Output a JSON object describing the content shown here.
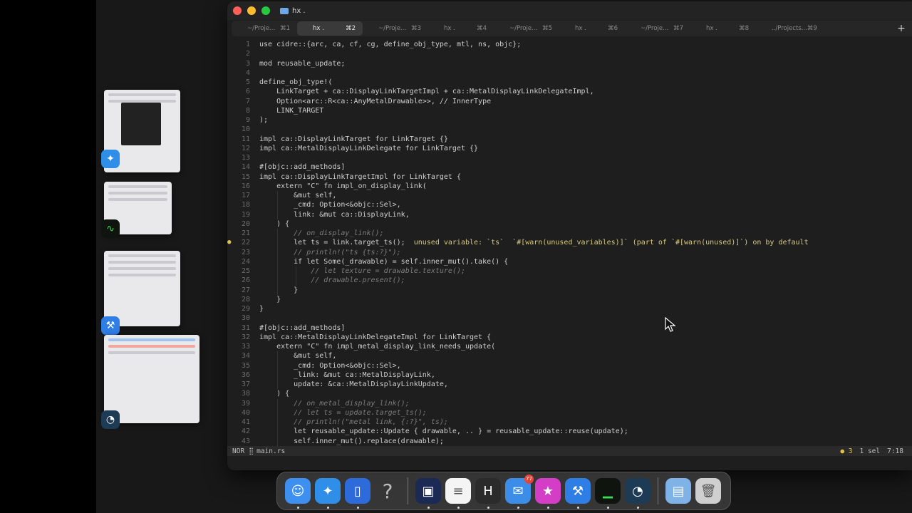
{
  "window": {
    "title": "hx .",
    "tabs": [
      {
        "label": "~/Proje...",
        "shortcut": "⌘1"
      },
      {
        "label": "hx .",
        "shortcut": "⌘2"
      },
      {
        "label": "~/Proje...",
        "shortcut": "⌘3"
      },
      {
        "label": "hx .",
        "shortcut": "⌘4"
      },
      {
        "label": "~/Proje...",
        "shortcut": "⌘5"
      },
      {
        "label": "hx .",
        "shortcut": "⌘6"
      },
      {
        "label": "~/Proje...",
        "shortcut": "⌘7"
      },
      {
        "label": "hx .",
        "shortcut": "⌘8"
      },
      {
        "label": "../Projects...",
        "shortcut": "⌘9"
      }
    ],
    "active_tab": 1,
    "new_tab_label": "+"
  },
  "editor": {
    "lines": [
      {
        "n": "1",
        "text": "use cidre::{arc, ca, cf, cg, define_obj_type, mtl, ns, objc};"
      },
      {
        "n": "2",
        "text": ""
      },
      {
        "n": "3",
        "text": "mod reusable_update;"
      },
      {
        "n": "4",
        "text": ""
      },
      {
        "n": "5",
        "text": "define_obj_type!("
      },
      {
        "n": "6",
        "text": "    LinkTarget + ca::DisplayLinkTargetImpl + ca::MetalDisplayLinkDelegateImpl,"
      },
      {
        "n": "7",
        "text": "    Option<arc::R<ca::AnyMetalDrawable>>, // InnerType"
      },
      {
        "n": "8",
        "text": "    LINK_TARGET"
      },
      {
        "n": "9",
        "text": ");"
      },
      {
        "n": "10",
        "text": ""
      },
      {
        "n": "11",
        "text": "impl ca::DisplayLinkTarget for LinkTarget {}"
      },
      {
        "n": "12",
        "text": "impl ca::MetalDisplayLinkDelegate for LinkTarget {}"
      },
      {
        "n": "13",
        "text": ""
      },
      {
        "n": "14",
        "text": "#[objc::add_methods]"
      },
      {
        "n": "15",
        "text": "impl ca::DisplayLinkTargetImpl for LinkTarget {"
      },
      {
        "n": "16",
        "text": "    extern \"C\" fn impl_on_display_link("
      },
      {
        "n": "17",
        "text": "        &mut self,"
      },
      {
        "n": "18",
        "text": "        _cmd: Option<&objc::Sel>,"
      },
      {
        "n": "19",
        "text": "        link: &mut ca::DisplayLink,"
      },
      {
        "n": "20",
        "text": "    ) {"
      },
      {
        "n": "21",
        "text": "        // on_display_link();"
      },
      {
        "n": "22",
        "text": "        let ts = link.target_ts();",
        "diagnostic": "  unused variable: `ts`  `#[warn(unused_variables)]` (part of `#[warn(unused)]`) on by default"
      },
      {
        "n": "23",
        "text": "        // println!(\"ts {ts:?}\");"
      },
      {
        "n": "24",
        "text": "        if let Some(_drawable) = self.inner_mut().take() {"
      },
      {
        "n": "25",
        "text": "            // let texture = drawable.texture();"
      },
      {
        "n": "26",
        "text": "            // drawable.present();"
      },
      {
        "n": "27",
        "text": "        }"
      },
      {
        "n": "28",
        "text": "    }"
      },
      {
        "n": "29",
        "text": "}"
      },
      {
        "n": "30",
        "text": ""
      },
      {
        "n": "31",
        "text": "#[objc::add_methods]"
      },
      {
        "n": "32",
        "text": "impl ca::MetalDisplayLinkDelegateImpl for LinkTarget {"
      },
      {
        "n": "33",
        "text": "    extern \"C\" fn impl_metal_display_link_needs_update("
      },
      {
        "n": "34",
        "text": "        &mut self,"
      },
      {
        "n": "35",
        "text": "        _cmd: Option<&objc::Sel>,"
      },
      {
        "n": "36",
        "text": "        _link: &mut ca::MetalDisplayLink,"
      },
      {
        "n": "37",
        "text": "        update: &ca::MetalDisplayLinkUpdate,"
      },
      {
        "n": "38",
        "text": "    ) {"
      },
      {
        "n": "39",
        "text": "        // on_metal_display_link();"
      },
      {
        "n": "40",
        "text": "        // let ts = update.target_ts();"
      },
      {
        "n": "41",
        "text": "        // println!(\"metal link, {:?}\", ts);"
      },
      {
        "n": "42",
        "text": "        let reusable_update::Update { drawable, .. } = reusable_update::reuse(update);"
      },
      {
        "n": "43",
        "text": "        self.inner_mut().replace(drawable);"
      }
    ]
  },
  "statusbar": {
    "mode": "NOR",
    "separator": "⣿",
    "file": "main.rs",
    "warnings": "● 3",
    "selections": "1 sel",
    "position": "7:18"
  },
  "dock": {
    "items": [
      {
        "name": "finder",
        "glyph": "☺",
        "color": "#3d8ff0",
        "running": true
      },
      {
        "name": "safari",
        "glyph": "✦",
        "color": "#2f8fe8",
        "running": true
      },
      {
        "name": "simulator",
        "glyph": "▯",
        "color": "#2c6bd9",
        "running": true
      },
      {
        "name": "help",
        "glyph": "?",
        "color": "transparent",
        "running": false
      },
      {
        "name": "terminal",
        "glyph": "▣",
        "color": "#1b2a55",
        "running": true
      },
      {
        "name": "notes",
        "glyph": "≡",
        "color": "#f4f4f4",
        "running": true
      },
      {
        "name": "helix",
        "glyph": "H",
        "color": "#2b2b2b",
        "running": true
      },
      {
        "name": "mail",
        "glyph": "✉",
        "color": "#3b8de8",
        "running": true,
        "badge": "77"
      },
      {
        "name": "itunes-store",
        "glyph": "★",
        "color": "#d43ec7",
        "running": true
      },
      {
        "name": "xcode-beta",
        "glyph": "⚒",
        "color": "#2f7ee6",
        "running": true
      },
      {
        "name": "activity-monitor",
        "glyph": "▁",
        "color": "#0f140f",
        "running": true
      },
      {
        "name": "instruments-beta",
        "glyph": "◔",
        "color": "#1d3b55",
        "running": true
      },
      {
        "name": "downloads",
        "glyph": "▤",
        "color": "#7fb3e8",
        "running": false
      },
      {
        "name": "trash",
        "glyph": "🗑",
        "color": "#cfcfcf",
        "running": false
      }
    ]
  },
  "colors": {
    "keyword": "#d4d4d4",
    "comment": "#7c7c7c",
    "warning": "#e0c24a",
    "close": "#ff5f57",
    "minimize": "#febc2e",
    "zoom": "#28c840"
  }
}
